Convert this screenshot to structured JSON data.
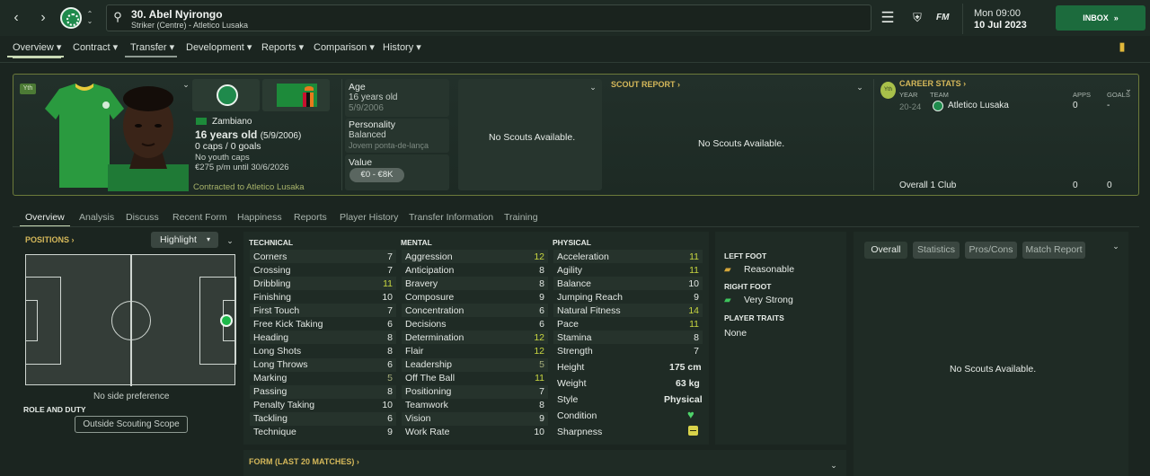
{
  "header": {
    "title": "30. Abel Nyirongo",
    "subtitle": "Striker (Centre) - Atletico Lusaka",
    "time": "Mon 09:00",
    "date": "10 Jul 2023",
    "fm": "FM",
    "inbox": "INBOX"
  },
  "menu": [
    "Overview",
    "Contract",
    "Transfer",
    "Development",
    "Reports",
    "Comparison",
    "History"
  ],
  "player": {
    "ythbadge": "Yth",
    "nationality": "Zambiano",
    "age_main": "16 years old",
    "age_dob": "(5/9/2006)",
    "caps": "0 caps / 0 goals",
    "youth_caps": "No youth caps",
    "wage": "€275 p/m until 30/6/2026",
    "contracted": "Contracted to Atletico Lusaka"
  },
  "info": {
    "age_label": "Age",
    "age_value": "16 years old",
    "dob": "5/9/2006",
    "personality_label": "Personality",
    "personality_value": "Balanced",
    "role_pt": "Jovem ponta-de-lança",
    "value_label": "Value",
    "value": "€0 - €8K"
  },
  "scouts": {
    "none": "No Scouts Available.",
    "report_title": "SCOUT REPORT"
  },
  "career": {
    "title": "CAREER STATS",
    "ythbadge": "Yth",
    "col_year": "YEAR",
    "col_team": "TEAM",
    "col_apps": "APPS",
    "col_goals": "GOALS",
    "year": "20-24",
    "team": "Atletico Lusaka",
    "apps": "0",
    "goals": "-",
    "overall": "Overall 1 Club",
    "overall_apps": "0",
    "overall_goals": "0"
  },
  "subtabs": [
    "Overview",
    "Analysis",
    "Discuss",
    "Recent Form",
    "Happiness",
    "Reports",
    "Player History",
    "Transfer Information",
    "Training"
  ],
  "positions": {
    "title": "POSITIONS",
    "highlight": "Highlight",
    "no_side": "No side preference",
    "role_duty": "ROLE AND DUTY",
    "scope": "Outside Scouting Scope"
  },
  "technical": {
    "title": "TECHNICAL",
    "rows": [
      [
        "Corners",
        "7"
      ],
      [
        "Crossing",
        "7"
      ],
      [
        "Dribbling",
        "11"
      ],
      [
        "Finishing",
        "10"
      ],
      [
        "First Touch",
        "7"
      ],
      [
        "Free Kick Taking",
        "6"
      ],
      [
        "Heading",
        "8"
      ],
      [
        "Long Shots",
        "8"
      ],
      [
        "Long Throws",
        "6"
      ],
      [
        "Marking",
        "5"
      ],
      [
        "Passing",
        "8"
      ],
      [
        "Penalty Taking",
        "10"
      ],
      [
        "Tackling",
        "6"
      ],
      [
        "Technique",
        "9"
      ]
    ]
  },
  "mental": {
    "title": "MENTAL",
    "rows": [
      [
        "Aggression",
        "12"
      ],
      [
        "Anticipation",
        "8"
      ],
      [
        "Bravery",
        "8"
      ],
      [
        "Composure",
        "9"
      ],
      [
        "Concentration",
        "6"
      ],
      [
        "Decisions",
        "6"
      ],
      [
        "Determination",
        "12"
      ],
      [
        "Flair",
        "12"
      ],
      [
        "Leadership",
        "5"
      ],
      [
        "Off The Ball",
        "11"
      ],
      [
        "Positioning",
        "7"
      ],
      [
        "Teamwork",
        "8"
      ],
      [
        "Vision",
        "9"
      ],
      [
        "Work Rate",
        "10"
      ]
    ]
  },
  "physical": {
    "title": "PHYSICAL",
    "rows": [
      [
        "Acceleration",
        "11"
      ],
      [
        "Agility",
        "11"
      ],
      [
        "Balance",
        "10"
      ],
      [
        "Jumping Reach",
        "9"
      ],
      [
        "Natural Fitness",
        "14"
      ],
      [
        "Pace",
        "11"
      ],
      [
        "Stamina",
        "8"
      ],
      [
        "Strength",
        "7"
      ]
    ],
    "extra": [
      [
        "Height",
        "175 cm"
      ],
      [
        "Weight",
        "63 kg"
      ],
      [
        "Style",
        "Physical"
      ],
      [
        "Condition",
        ""
      ],
      [
        "Sharpness",
        ""
      ]
    ]
  },
  "feet": {
    "left_label": "LEFT FOOT",
    "left": "Reasonable",
    "right_label": "RIGHT FOOT",
    "right": "Very Strong",
    "traits_label": "PLAYER TRAITS",
    "traits": "None"
  },
  "rightpanel": {
    "tabs": [
      "Overall",
      "Statistics",
      "Pros/Cons",
      "Match Report"
    ],
    "none": "No Scouts Available."
  },
  "form": {
    "title": "FORM (LAST 20 MATCHES)"
  }
}
